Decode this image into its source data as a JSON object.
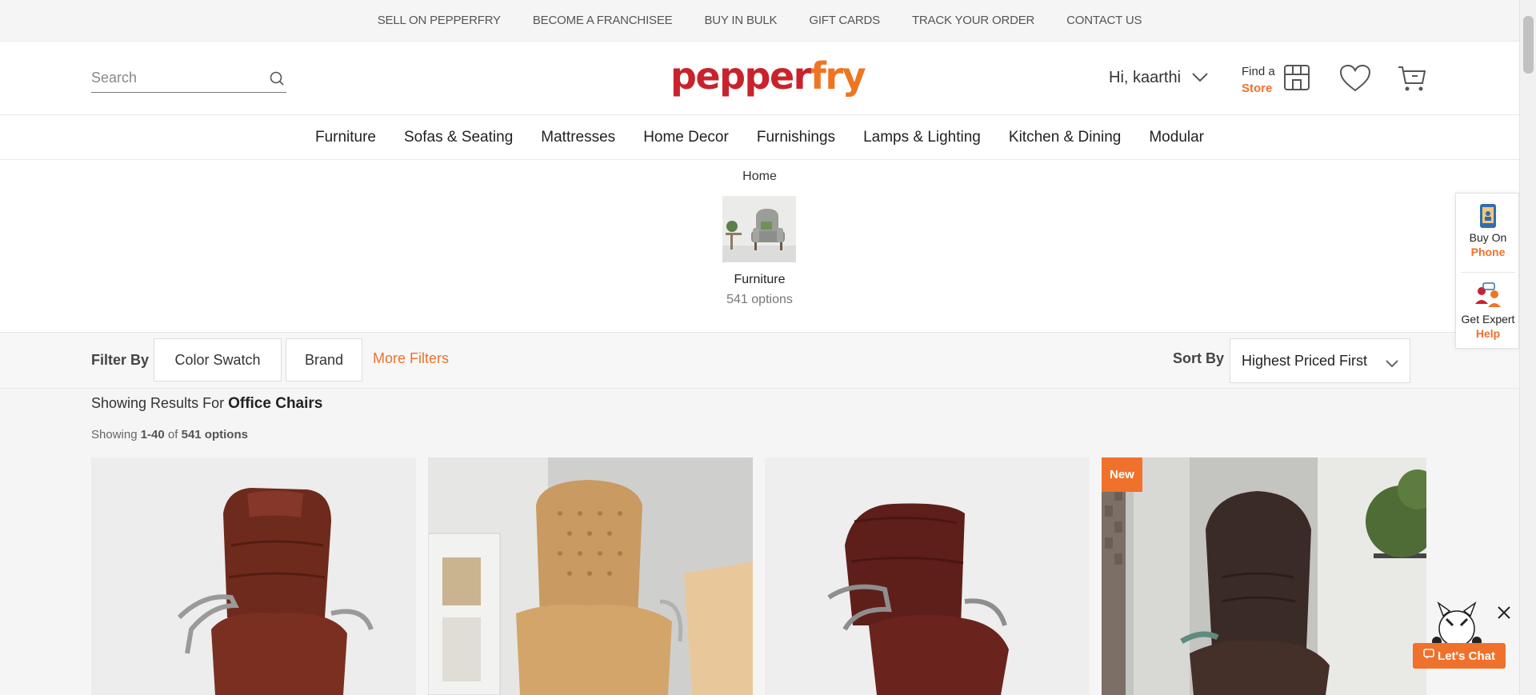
{
  "topbar": {
    "links": [
      "SELL ON PEPPERFRY",
      "BECOME A FRANCHISEE",
      "BUY IN BULK",
      "GIFT CARDS",
      "TRACK YOUR ORDER",
      "CONTACT US"
    ]
  },
  "header": {
    "search_placeholder": "Search",
    "logo_part1": "pepper",
    "logo_part2": "fry",
    "greeting": "Hi, kaarthi",
    "find_store_line1": "Find a",
    "find_store_line2": "Store"
  },
  "nav": {
    "items": [
      "Furniture",
      "Sofas & Seating",
      "Mattresses",
      "Home Decor",
      "Furnishings",
      "Lamps & Lighting",
      "Kitchen & Dining",
      "Modular"
    ]
  },
  "category": {
    "breadcrumb": "Home",
    "name": "Furniture",
    "count": "541 options"
  },
  "filters": {
    "label": "Filter By",
    "buttons": [
      "Color Swatch",
      "Brand"
    ],
    "more": "More Filters",
    "sort_label": "Sort By",
    "sort_value": "Highest Priced First"
  },
  "results": {
    "prefix": "Showing Results For",
    "query": "Office Chairs",
    "count_prefix": "Showing",
    "range": "1-40",
    "of": "of",
    "total": "541 options"
  },
  "products": [
    {
      "badge": ""
    },
    {
      "badge": ""
    },
    {
      "badge": ""
    },
    {
      "badge": "New"
    }
  ],
  "side_widget": {
    "buy_line1": "Buy On",
    "buy_line2": "Phone",
    "help_line1": "Get Expert",
    "help_line2": "Help"
  },
  "chat": {
    "label": "Let's Chat"
  },
  "colors": {
    "brand_red": "#c8232c",
    "brand_orange": "#f0712b"
  }
}
